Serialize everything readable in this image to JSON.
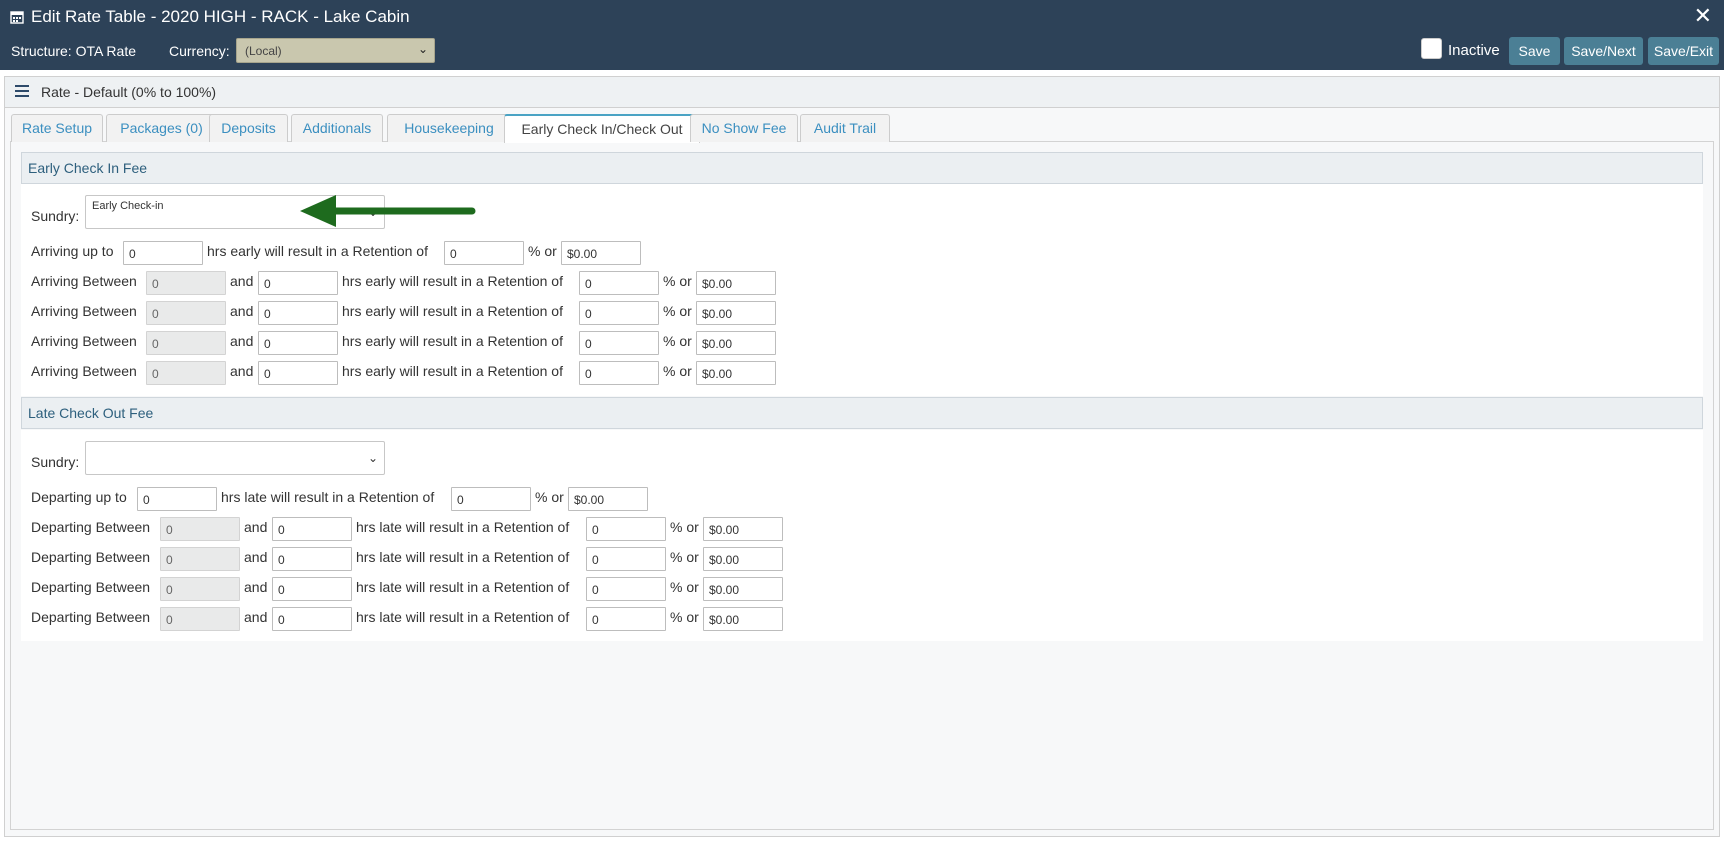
{
  "window": {
    "title": "Edit Rate Table - 2020 HIGH - RACK - Lake Cabin",
    "close_glyph": "✕"
  },
  "toolbar": {
    "structure": "Structure: OTA Rate",
    "currency_label": "Currency:",
    "currency_value": "(Local)",
    "inactive_label": "Inactive",
    "save": "Save",
    "save_next": "Save/Next",
    "save_exit": "Save/Exit"
  },
  "panel": {
    "title": "Rate - Default (0% to 100%)"
  },
  "tabs": [
    {
      "label": "Rate Setup"
    },
    {
      "label": "Packages (0)"
    },
    {
      "label": "Deposits"
    },
    {
      "label": "Additionals"
    },
    {
      "label": "Housekeeping"
    },
    {
      "label": "Early Check In/Check Out"
    },
    {
      "label": "No Show Fee"
    },
    {
      "label": "Audit Trail"
    }
  ],
  "active_tab": "Early Check In/Check Out",
  "early": {
    "header": "Early Check In Fee",
    "sundry_label": "Sundry:",
    "sundry_value": "Early Check-in",
    "first_row": {
      "prefix": "Arriving up to",
      "hrs": "0",
      "mid": "hrs early will result in a Retention of",
      "pct": "0",
      "pct_or": "% or",
      "amount": "$0.00"
    },
    "between_prefix": "Arriving Between",
    "and": "and",
    "mid": "hrs early will result in a Retention of",
    "pct_or": "% or",
    "rows": [
      {
        "from": "0",
        "to": "0",
        "pct": "0",
        "amount": "$0.00"
      },
      {
        "from": "0",
        "to": "0",
        "pct": "0",
        "amount": "$0.00"
      },
      {
        "from": "0",
        "to": "0",
        "pct": "0",
        "amount": "$0.00"
      },
      {
        "from": "0",
        "to": "0",
        "pct": "0",
        "amount": "$0.00"
      }
    ]
  },
  "late": {
    "header": "Late Check Out Fee",
    "sundry_label": "Sundry:",
    "sundry_value": "",
    "first_row": {
      "prefix": "Departing up to",
      "hrs": "0",
      "mid": "hrs late will result in a Retention of",
      "pct": "0",
      "pct_or": "% or",
      "amount": "$0.00"
    },
    "between_prefix": "Departing Between",
    "and": "and",
    "mid": "hrs late will result in a Retention of",
    "pct_or": "% or",
    "rows": [
      {
        "from": "0",
        "to": "0",
        "pct": "0",
        "amount": "$0.00"
      },
      {
        "from": "0",
        "to": "0",
        "pct": "0",
        "amount": "$0.00"
      },
      {
        "from": "0",
        "to": "0",
        "pct": "0",
        "amount": "$0.00"
      },
      {
        "from": "0",
        "to": "0",
        "pct": "0",
        "amount": "$0.00"
      }
    ]
  },
  "colors": {
    "titlebar": "#2d4258",
    "button": "#4b7f95",
    "arrow": "#1e6b1e",
    "tab_text": "#3b8fc0"
  }
}
